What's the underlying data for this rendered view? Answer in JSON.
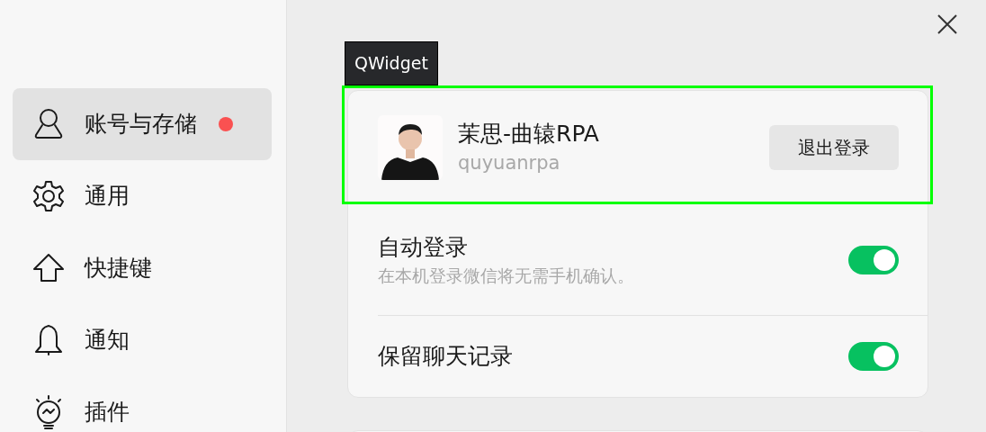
{
  "sidebar": {
    "items": [
      {
        "label": "账号与存储",
        "kind": "person",
        "selected": true,
        "badge": true
      },
      {
        "label": "通用",
        "kind": "gear",
        "selected": false,
        "badge": false
      },
      {
        "label": "快捷键",
        "kind": "arrow",
        "selected": false,
        "badge": false
      },
      {
        "label": "通知",
        "kind": "bell",
        "selected": false,
        "badge": false
      },
      {
        "label": "插件",
        "kind": "bulb",
        "selected": false,
        "badge": false
      }
    ]
  },
  "inspector": {
    "label": "QWidget"
  },
  "account": {
    "name": "茉思-曲辕RPA",
    "id": "quyuanrpa",
    "logout_button": "退出登录"
  },
  "settings": [
    {
      "title": "自动登录",
      "description": "在本机登录微信将无需手机确认。",
      "on": true
    },
    {
      "title": "保留聊天记录",
      "on": true
    }
  ]
}
